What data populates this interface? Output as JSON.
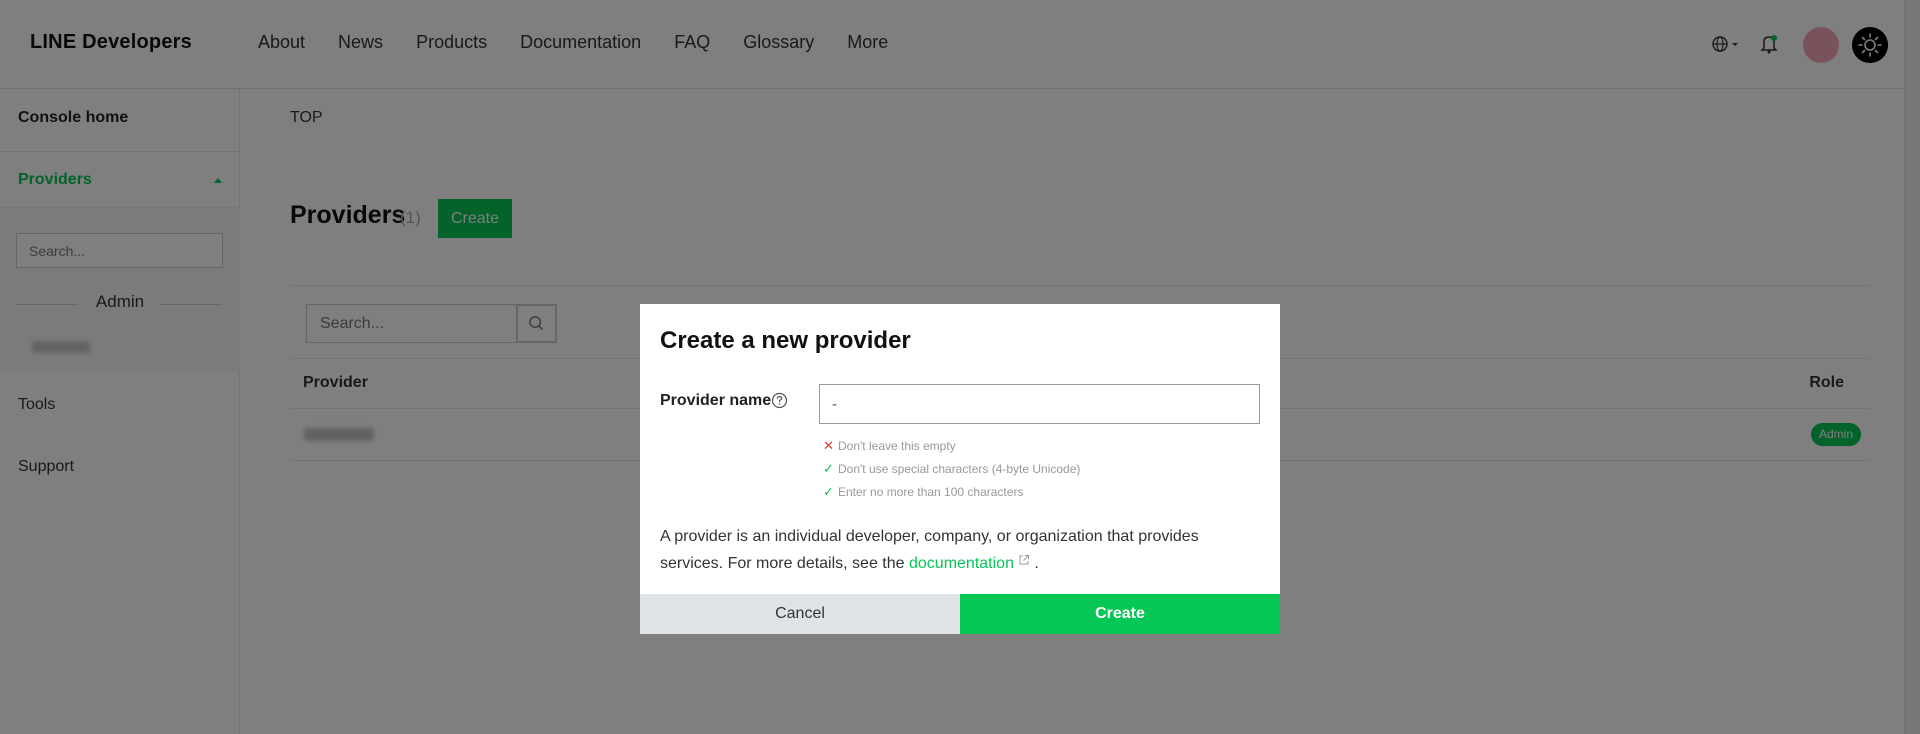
{
  "header": {
    "brand": "LINE Developers",
    "nav": [
      "About",
      "News",
      "Products",
      "Documentation",
      "FAQ",
      "Glossary",
      "More"
    ]
  },
  "sidebar": {
    "console_home": "Console home",
    "providers": "Providers",
    "search_placeholder": "Search...",
    "group_label": "Admin",
    "tools": "Tools",
    "support": "Support"
  },
  "main": {
    "breadcrumb": "TOP",
    "title": "Providers",
    "count": "(1)",
    "create_label": "Create",
    "search_placeholder": "Search...",
    "table": {
      "columns": [
        "Provider",
        "Role"
      ],
      "rows": [
        {
          "role": "Admin"
        }
      ]
    }
  },
  "modal": {
    "title": "Create a new provider",
    "field_label": "Provider name",
    "input_value": "-",
    "hints": [
      {
        "status": "error",
        "text": "Don't leave this empty"
      },
      {
        "status": "ok",
        "text": "Don't use special characters (4-byte Unicode)"
      },
      {
        "status": "ok",
        "text": "Enter no more than 100 characters"
      }
    ],
    "description_text": "A provider is an individual developer, company, or organization that provides services. For more details, see the",
    "link_text": "documentation",
    "description_end": ".",
    "cancel_label": "Cancel",
    "create_label": "Create"
  },
  "colors": {
    "accent": "#06c755",
    "error": "#e53935",
    "overlay": "rgba(0,0,0,0.5)"
  }
}
